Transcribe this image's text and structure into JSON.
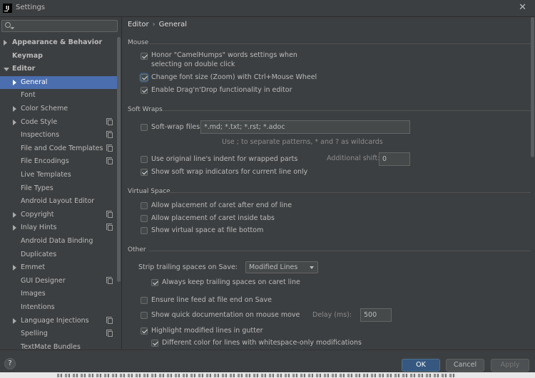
{
  "window": {
    "title": "Settings",
    "app_icon_text": "IJ",
    "close_glyph": "✕"
  },
  "sidebar": {
    "search_placeholder": "",
    "items": [
      {
        "label": "Appearance & Behavior",
        "level": 0,
        "arrow": "right",
        "bold": true,
        "copy": false,
        "selected": false
      },
      {
        "label": "Keymap",
        "level": 0,
        "arrow": "none",
        "bold": true,
        "copy": false,
        "selected": false
      },
      {
        "label": "Editor",
        "level": 0,
        "arrow": "down",
        "bold": true,
        "copy": false,
        "selected": false
      },
      {
        "label": "General",
        "level": 1,
        "arrow": "right",
        "bold": false,
        "copy": false,
        "selected": true
      },
      {
        "label": "Font",
        "level": 1,
        "arrow": "none",
        "bold": false,
        "copy": false,
        "selected": false
      },
      {
        "label": "Color Scheme",
        "level": 1,
        "arrow": "right",
        "bold": false,
        "copy": false,
        "selected": false
      },
      {
        "label": "Code Style",
        "level": 1,
        "arrow": "right",
        "bold": false,
        "copy": true,
        "selected": false
      },
      {
        "label": "Inspections",
        "level": 1,
        "arrow": "none",
        "bold": false,
        "copy": true,
        "selected": false
      },
      {
        "label": "File and Code Templates",
        "level": 1,
        "arrow": "none",
        "bold": false,
        "copy": true,
        "selected": false
      },
      {
        "label": "File Encodings",
        "level": 1,
        "arrow": "none",
        "bold": false,
        "copy": true,
        "selected": false
      },
      {
        "label": "Live Templates",
        "level": 1,
        "arrow": "none",
        "bold": false,
        "copy": false,
        "selected": false
      },
      {
        "label": "File Types",
        "level": 1,
        "arrow": "none",
        "bold": false,
        "copy": false,
        "selected": false
      },
      {
        "label": "Android Layout Editor",
        "level": 1,
        "arrow": "none",
        "bold": false,
        "copy": false,
        "selected": false
      },
      {
        "label": "Copyright",
        "level": 1,
        "arrow": "right",
        "bold": false,
        "copy": true,
        "selected": false
      },
      {
        "label": "Inlay Hints",
        "level": 1,
        "arrow": "right",
        "bold": false,
        "copy": true,
        "selected": false
      },
      {
        "label": "Android Data Binding",
        "level": 1,
        "arrow": "none",
        "bold": false,
        "copy": false,
        "selected": false
      },
      {
        "label": "Duplicates",
        "level": 1,
        "arrow": "none",
        "bold": false,
        "copy": false,
        "selected": false
      },
      {
        "label": "Emmet",
        "level": 1,
        "arrow": "right",
        "bold": false,
        "copy": false,
        "selected": false
      },
      {
        "label": "GUI Designer",
        "level": 1,
        "arrow": "none",
        "bold": false,
        "copy": true,
        "selected": false
      },
      {
        "label": "Images",
        "level": 1,
        "arrow": "none",
        "bold": false,
        "copy": false,
        "selected": false
      },
      {
        "label": "Intentions",
        "level": 1,
        "arrow": "none",
        "bold": false,
        "copy": false,
        "selected": false
      },
      {
        "label": "Language Injections",
        "level": 1,
        "arrow": "right",
        "bold": false,
        "copy": true,
        "selected": false
      },
      {
        "label": "Spelling",
        "level": 1,
        "arrow": "none",
        "bold": false,
        "copy": true,
        "selected": false
      },
      {
        "label": "TextMate Bundles",
        "level": 1,
        "arrow": "none",
        "bold": false,
        "copy": false,
        "selected": false
      }
    ]
  },
  "content": {
    "breadcrumb": {
      "parent": "Editor",
      "separator": "›",
      "current": "General"
    },
    "sections": {
      "mouse": "Mouse",
      "soft_wraps": "Soft Wraps",
      "virtual_space": "Virtual Space",
      "other": "Other"
    },
    "mouse": {
      "camelhumps": {
        "label": "Honor \"CamelHumps\" words settings when selecting on double click",
        "checked": true
      },
      "zoom": {
        "label": "Change font size (Zoom) with Ctrl+Mouse Wheel",
        "checked": true
      },
      "dragdrop": {
        "label": "Enable Drag'n'Drop functionality in editor",
        "checked": true
      }
    },
    "soft_wraps": {
      "softwrap_files": {
        "label": "Soft-wrap files:",
        "checked": false,
        "value": "*.md; *.txt; *.rst; *.adoc"
      },
      "hint": "Use ; to separate patterns, * and ? as wildcards",
      "original_indent": {
        "label": "Use original line's indent for wrapped parts",
        "checked": false
      },
      "additional_shift_label": "Additional shift:",
      "additional_shift_value": "0",
      "show_indicators": {
        "label": "Show soft wrap indicators for current line only",
        "checked": true
      }
    },
    "virtual_space": {
      "after_end": {
        "label": "Allow placement of caret after end of line",
        "checked": false
      },
      "inside_tabs": {
        "label": "Allow placement of caret inside tabs",
        "checked": false
      },
      "file_bottom": {
        "label": "Show virtual space at file bottom",
        "checked": false
      }
    },
    "other": {
      "strip_label": "Strip trailing spaces on Save:",
      "strip_value": "Modified Lines",
      "keep_trailing": {
        "label": "Always keep trailing spaces on caret line",
        "checked": true
      },
      "line_feed": {
        "label": "Ensure line feed at file end on Save",
        "checked": false
      },
      "quick_doc": {
        "label": "Show quick documentation on mouse move",
        "checked": false
      },
      "delay_label": "Delay (ms):",
      "delay_value": "500",
      "highlight_modified": {
        "label": "Highlight modified lines in gutter",
        "checked": true
      },
      "whitespace_color": {
        "label": "Different color for lines with whitespace-only modifications",
        "checked": true
      }
    }
  },
  "footer": {
    "help": "?",
    "ok": "OK",
    "cancel": "Cancel",
    "apply": "Apply"
  },
  "colors": {
    "background": "#3c3f41",
    "selection": "#4b6eaf",
    "primary_button": "#365880",
    "text": "#bbbbbb"
  }
}
